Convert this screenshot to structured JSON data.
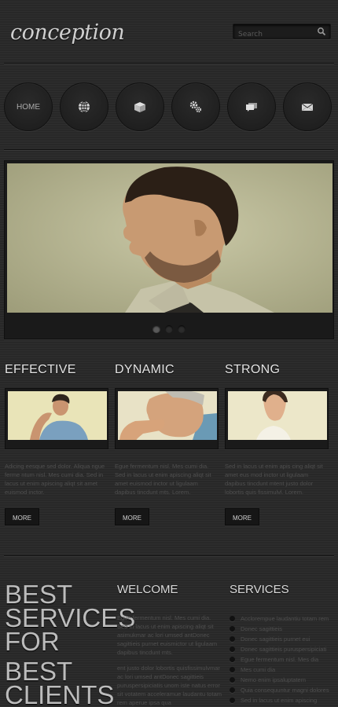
{
  "brand": {
    "logo": "conception"
  },
  "search": {
    "placeholder": "Search"
  },
  "nav": [
    {
      "label": "HOME",
      "icon": "home"
    },
    {
      "label": "",
      "icon": "globe-icon"
    },
    {
      "label": "",
      "icon": "box-icon"
    },
    {
      "label": "",
      "icon": "gears-icon"
    },
    {
      "label": "",
      "icon": "chat-icon"
    },
    {
      "label": "",
      "icon": "mail-icon"
    }
  ],
  "slider": {
    "dots": 3,
    "active": 0
  },
  "features": [
    {
      "title": "EFFECTIVE",
      "text": "Adicing eesque sed dolor. Aliqua ngue ferme ntum nisl. Mes cumi dia. Sed in lacus ut enim apiscing aliqt sit amet euismod inctor.",
      "more": "MORE"
    },
    {
      "title": "DYNAMIC",
      "text": "Egue fermentum nisl. Mes cumi dia. Sed in lacus ut enim apiscing aliqt sit amet euismod inctor ut ligulaam dapibus tincdunt mts. Lorem.",
      "more": "MORE"
    },
    {
      "title": "STRONG",
      "text": "Sed in lacus ut enim apis cing aliqt sit amet eus mod inctor ut ligulaam dapibus tincdunt mtent justo dolor lobortis quis fissimulvl. Lorem.",
      "more": "MORE"
    }
  ],
  "tagline": {
    "line1": "BEST",
    "line2": "SERVICES",
    "line3": "FOR",
    "line4": "BEST",
    "line5": "CLIENTS"
  },
  "welcome": {
    "title": "WELCOME",
    "p1": "Egue fermentum nisl. Mes cumi dia. Sed in lacus ut enim apiscing aliqt sit asimukmar ac lori umsed antDonec sagittieis purnet euismictor ut ligulaam dapibus tincdunt mts.",
    "p2": "ent justo dolor lobortis quisfissimulvmar ac lori umsed antDonec sagittieis puruspersipiciatis unom iste natus error sit votatem acceleramue laudantu totam rem aperue ipsa qua"
  },
  "services": {
    "title": "SERVICES",
    "items": [
      "Acclorempue laudantiu totam rem",
      "Donec sagittieis",
      "Donec sagittieis purnet eui",
      "Donec sagittieis puruspersipiciati",
      "Egue fermentum nisl. Mes dia",
      "Mes cumi dia",
      "Nemo enim ipsaluptatem",
      "Quia consequuntur magni dolores",
      "Sed in lacus ut enim apiscing"
    ]
  }
}
